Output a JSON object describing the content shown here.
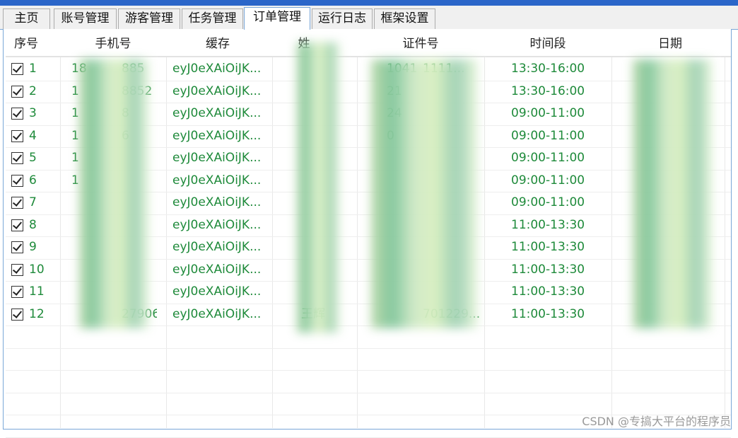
{
  "tabs": [
    "主页",
    "账号管理",
    "游客管理",
    "任务管理",
    "订单管理",
    "运行日志",
    "框架设置"
  ],
  "active_tab": "订单管理",
  "columns": [
    "序号",
    "手机号",
    "缓存",
    "姓",
    "证件号",
    "时间段",
    "日期"
  ],
  "rows": [
    {
      "idx": "1",
      "phone": "18",
      "phone2": "885",
      "cache": "eyJ0eXAiOiJK...",
      "name": "",
      "id": "1041",
      "id2": "1111...",
      "time": "13:30-16:00"
    },
    {
      "idx": "2",
      "phone": "1",
      "phone2": "8852",
      "cache": "eyJ0eXAiOiJK...",
      "name": "",
      "id": "21",
      "id2": "",
      "time": "13:30-16:00"
    },
    {
      "idx": "3",
      "phone": "1",
      "phone2": "8",
      "cache": "eyJ0eXAiOiJK...",
      "name": "",
      "id": "24",
      "id2": "",
      "time": "09:00-11:00"
    },
    {
      "idx": "4",
      "phone": "1",
      "phone2": "6",
      "cache": "eyJ0eXAiOiJK...",
      "name": "",
      "id": "0",
      "id2": "",
      "time": "09:00-11:00"
    },
    {
      "idx": "5",
      "phone": "1",
      "phone2": "",
      "cache": "eyJ0eXAiOiJK...",
      "name": "",
      "id": "",
      "id2": "",
      "time": "09:00-11:00"
    },
    {
      "idx": "6",
      "phone": "1",
      "phone2": "",
      "cache": "eyJ0eXAiOiJK...",
      "name": "",
      "id": "",
      "id2": "",
      "time": "09:00-11:00"
    },
    {
      "idx": "7",
      "phone": "",
      "phone2": "",
      "cache": "eyJ0eXAiOiJK...",
      "name": "",
      "id": "",
      "id2": "",
      "time": "09:00-11:00"
    },
    {
      "idx": "8",
      "phone": "",
      "phone2": "",
      "cache": "eyJ0eXAiOiJK...",
      "name": "",
      "id": "",
      "id2": "",
      "time": "11:00-13:30"
    },
    {
      "idx": "9",
      "phone": "",
      "phone2": "",
      "cache": "eyJ0eXAiOiJK...",
      "name": "",
      "id": "",
      "id2": "",
      "time": "11:00-13:30"
    },
    {
      "idx": "10",
      "phone": "",
      "phone2": "",
      "cache": "eyJ0eXAiOiJK...",
      "name": "",
      "id": "",
      "id2": "",
      "time": "11:00-13:30"
    },
    {
      "idx": "11",
      "phone": "",
      "phone2": "",
      "cache": "eyJ0eXAiOiJK...",
      "name": "",
      "id": "",
      "id2": "",
      "time": "11:00-13:30"
    },
    {
      "idx": "12",
      "phone": "",
      "phone2": "27906",
      "cache": "eyJ0eXAiOiJK...",
      "name": "王辉",
      "id": "",
      "id2": "701229...",
      "time": "11:00-13:30"
    }
  ],
  "watermark": "CSDN @专搞大平台的程序员",
  "colors": {
    "row_text": "#1e8a3a",
    "tab_active_border": "#7aa7d8"
  }
}
